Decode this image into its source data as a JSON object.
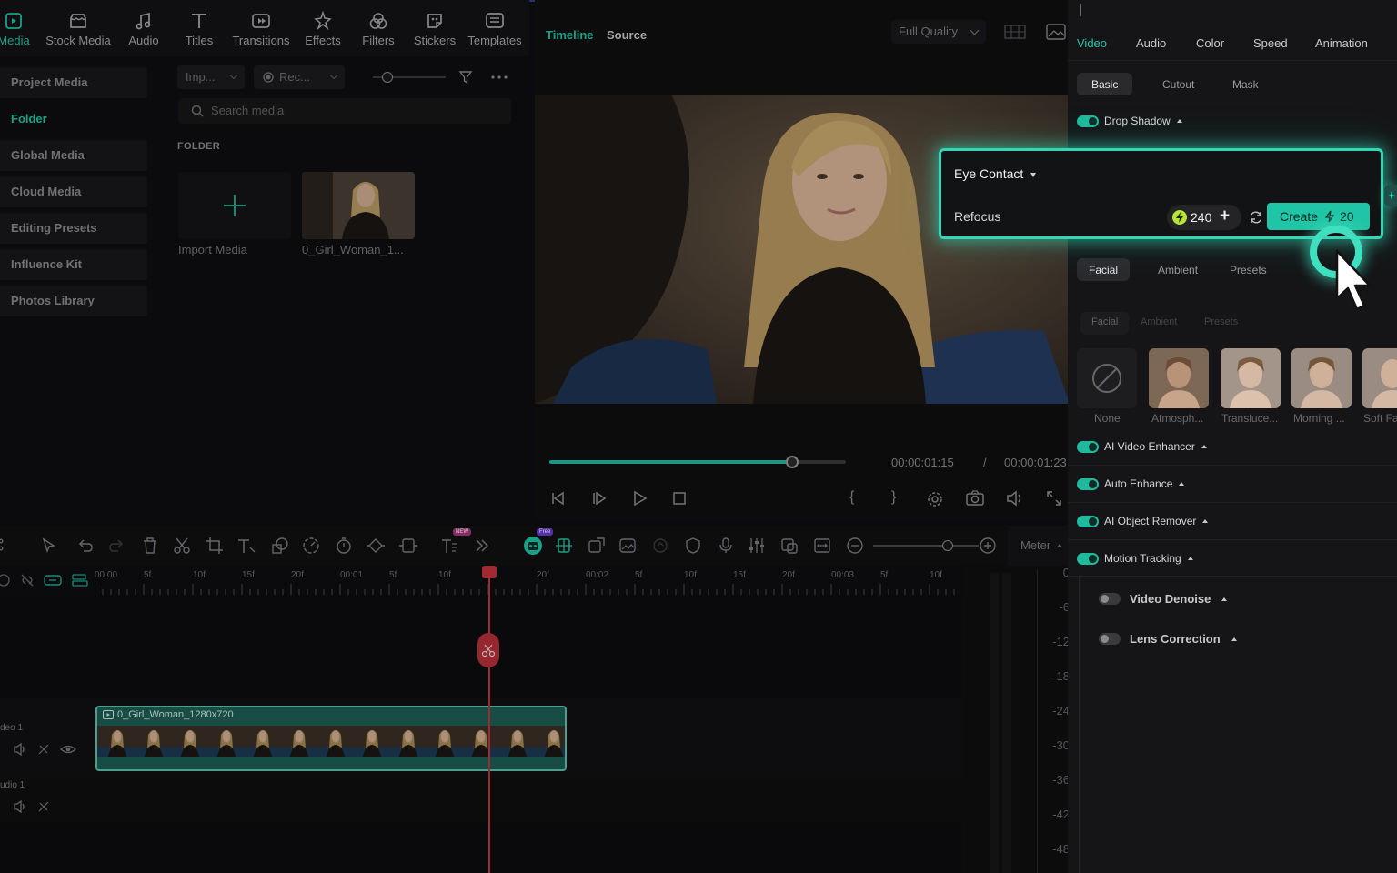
{
  "toolbar": {
    "items": [
      {
        "label": "Media",
        "icon": "media-icon",
        "active": true
      },
      {
        "label": "Stock Media",
        "icon": "stock-media-icon"
      },
      {
        "label": "Audio",
        "icon": "audio-icon"
      },
      {
        "label": "Titles",
        "icon": "titles-icon"
      },
      {
        "label": "Transitions",
        "icon": "transitions-icon"
      },
      {
        "label": "Effects",
        "icon": "effects-icon"
      },
      {
        "label": "Filters",
        "icon": "filters-icon"
      },
      {
        "label": "Stickers",
        "icon": "stickers-icon"
      },
      {
        "label": "Templates",
        "icon": "templates-icon"
      }
    ]
  },
  "sidebar": {
    "items": [
      {
        "label": "Project Media"
      },
      {
        "label": "Folder",
        "active": true
      },
      {
        "label": "Global Media"
      },
      {
        "label": "Cloud Media"
      },
      {
        "label": "Editing Presets"
      },
      {
        "label": "Influence Kit"
      },
      {
        "label": "Photos Library"
      }
    ]
  },
  "media": {
    "import_dropdown": "Imp...",
    "record_dropdown": "Rec...",
    "search_placeholder": "Search media",
    "folder_heading": "FOLDER",
    "import_label": "Import Media",
    "clip_label": "0_Girl_Woman_1..."
  },
  "player": {
    "tab_timeline": "Timeline",
    "tab_source": "Source",
    "quality": "Full Quality",
    "current_time": "00:00:01:15",
    "time_separator": "/",
    "total_time": "00:00:01:23",
    "progress": 0.82,
    "bracket_in": "{",
    "bracket_out": "}"
  },
  "inspector": {
    "tabs": [
      "Video",
      "Audio",
      "Color",
      "Speed",
      "Animation"
    ],
    "active_tab": "Video",
    "subtabs": [
      "Basic",
      "Cutout",
      "Mask"
    ],
    "drop_shadow": "Drop Shadow",
    "facial_tabs": [
      "Facial",
      "Ambient",
      "Presets"
    ],
    "facial_tabs_ghost": [
      "Facial",
      "Ambient",
      "Presets"
    ],
    "presets": [
      "None",
      "Atmosph...",
      "Transluce...",
      "Morning ...",
      "Soft Fa"
    ],
    "toggles": [
      {
        "label": "AI Video Enhancer",
        "on": true
      },
      {
        "label": "Auto Enhance",
        "on": true
      },
      {
        "label": "AI Object Remover",
        "on": true
      },
      {
        "label": "Motion Tracking",
        "on": true
      }
    ],
    "off_toggles": [
      {
        "label": "Video Denoise",
        "on": false
      },
      {
        "label": "Lens Correction",
        "on": false
      }
    ]
  },
  "popup": {
    "title": "Eye Contact",
    "subtitle": "Refocus",
    "credits": "240",
    "credits_plus": "+",
    "create_label": "Create",
    "create_cost": "20"
  },
  "timeline": {
    "badge_new": "NEW",
    "badge_free": "Free",
    "meter_label": "Meter",
    "ruler_labels": [
      "00:00",
      "5f",
      "10f",
      "15f",
      "20f",
      "00:01",
      "5f",
      "10f",
      "5f",
      "20f",
      "00:02",
      "5f",
      "10f",
      "15f",
      "20f",
      "00:03",
      "5f",
      "10f"
    ],
    "meter_levels": [
      "0",
      "-6",
      "-12",
      "-18",
      "-24",
      "-30",
      "-36",
      "-42",
      "-48"
    ],
    "clip_name": "0_Girl_Woman_1280x720",
    "video_track": "deo 1",
    "audio_track": "udio 1"
  },
  "colors": {
    "accent": "#1fc5a6",
    "glow": "#35d6b6",
    "playhead": "#c4343e",
    "clip": "#1d5f55"
  }
}
